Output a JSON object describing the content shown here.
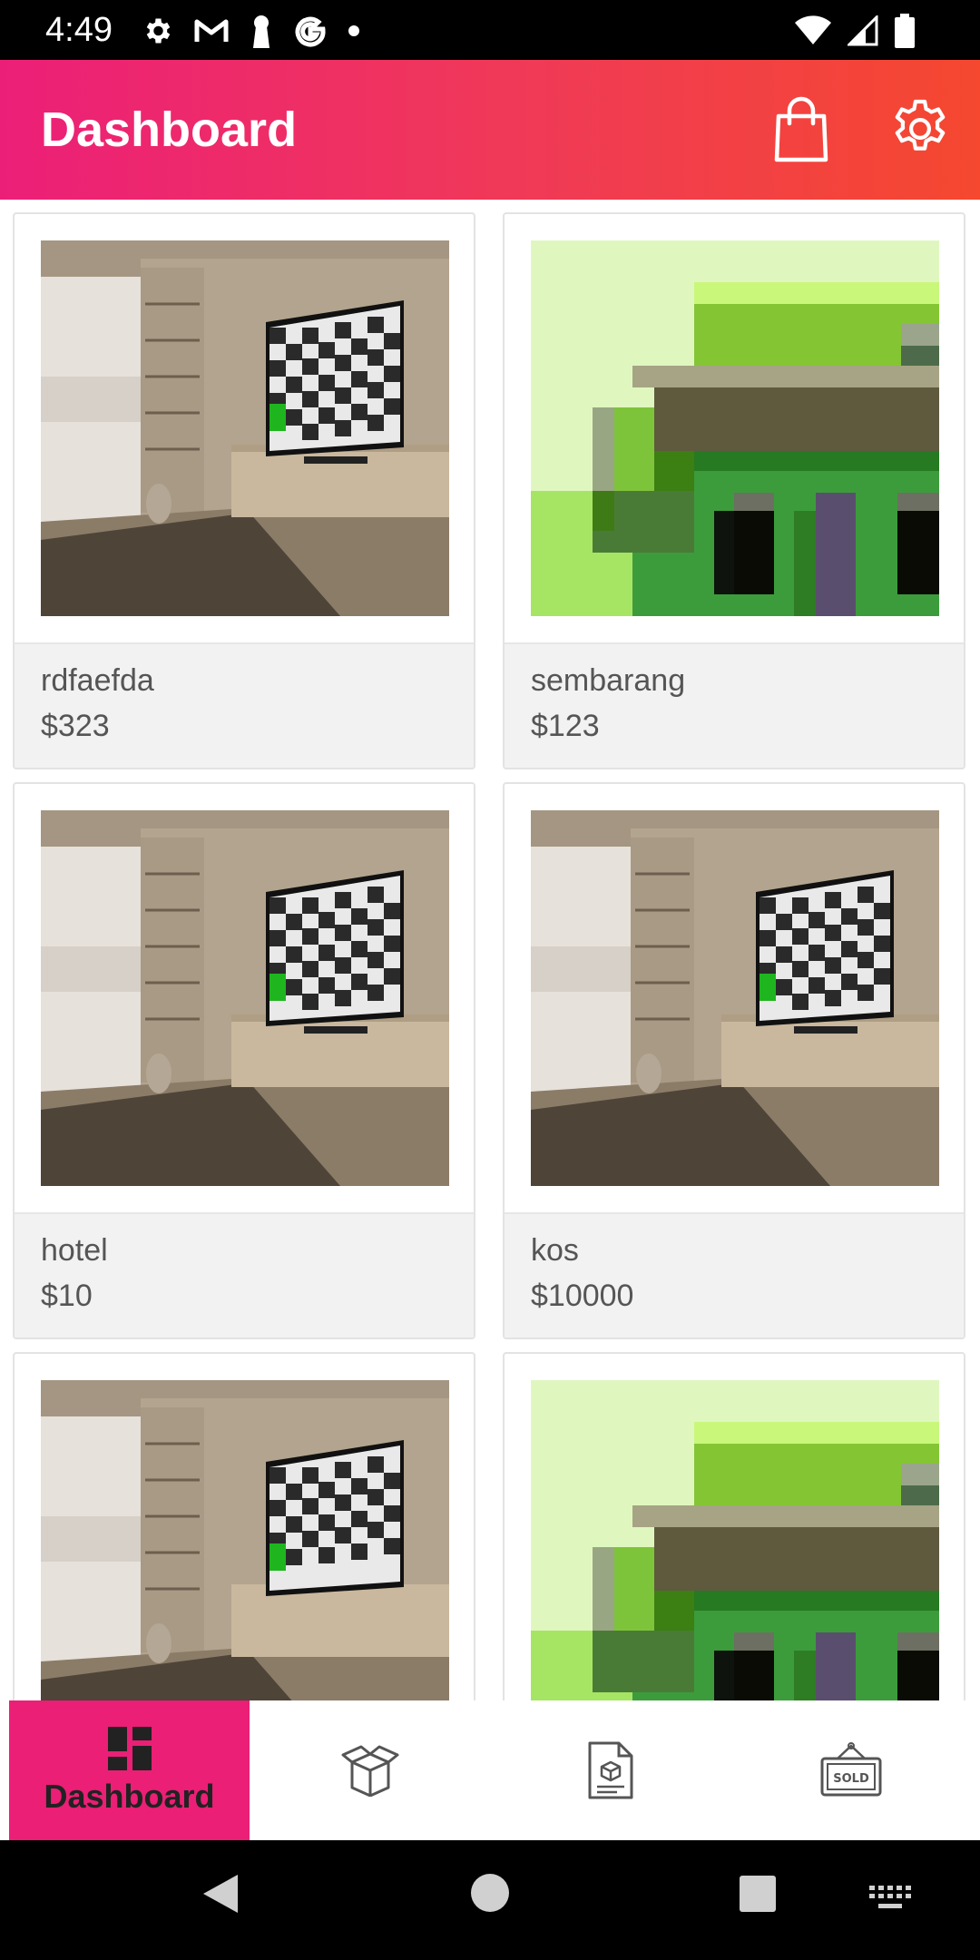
{
  "status_bar": {
    "time": "4:49",
    "left_icons": [
      "gear-icon",
      "gmail-icon",
      "keyhole-icon",
      "google-icon",
      "dot-icon"
    ],
    "right_icons": [
      "wifi-icon",
      "signal-icon",
      "battery-icon"
    ]
  },
  "app_bar": {
    "title": "Dashboard",
    "actions": [
      "shopping-bag-icon",
      "gear-icon"
    ],
    "colors": {
      "start": "#ec1f78",
      "end": "#f5482f"
    }
  },
  "products": [
    {
      "name": "rdfaefda",
      "price": "$323",
      "image": "living-room-tv"
    },
    {
      "name": "sembarang",
      "price": "$123",
      "image": "pixel-house"
    },
    {
      "name": "hotel",
      "price": "$10",
      "image": "living-room-tv"
    },
    {
      "name": "kos",
      "price": "$10000",
      "image": "living-room-tv"
    },
    {
      "name": "",
      "price": "",
      "image": "living-room-tv"
    },
    {
      "name": "",
      "price": "",
      "image": "pixel-house"
    }
  ],
  "bottom_nav": {
    "active_color": "#ea1f75",
    "items": [
      {
        "label": "Dashboard",
        "icon": "dashboard-icon",
        "active": true
      },
      {
        "label": "",
        "icon": "box-icon",
        "active": false
      },
      {
        "label": "",
        "icon": "document-box-icon",
        "active": false
      },
      {
        "label": "",
        "icon": "sold-sign-icon",
        "active": false
      }
    ],
    "sold_text": "SOLD"
  },
  "system_nav": [
    "back-icon",
    "home-icon",
    "recents-icon",
    "keyboard-icon"
  ]
}
